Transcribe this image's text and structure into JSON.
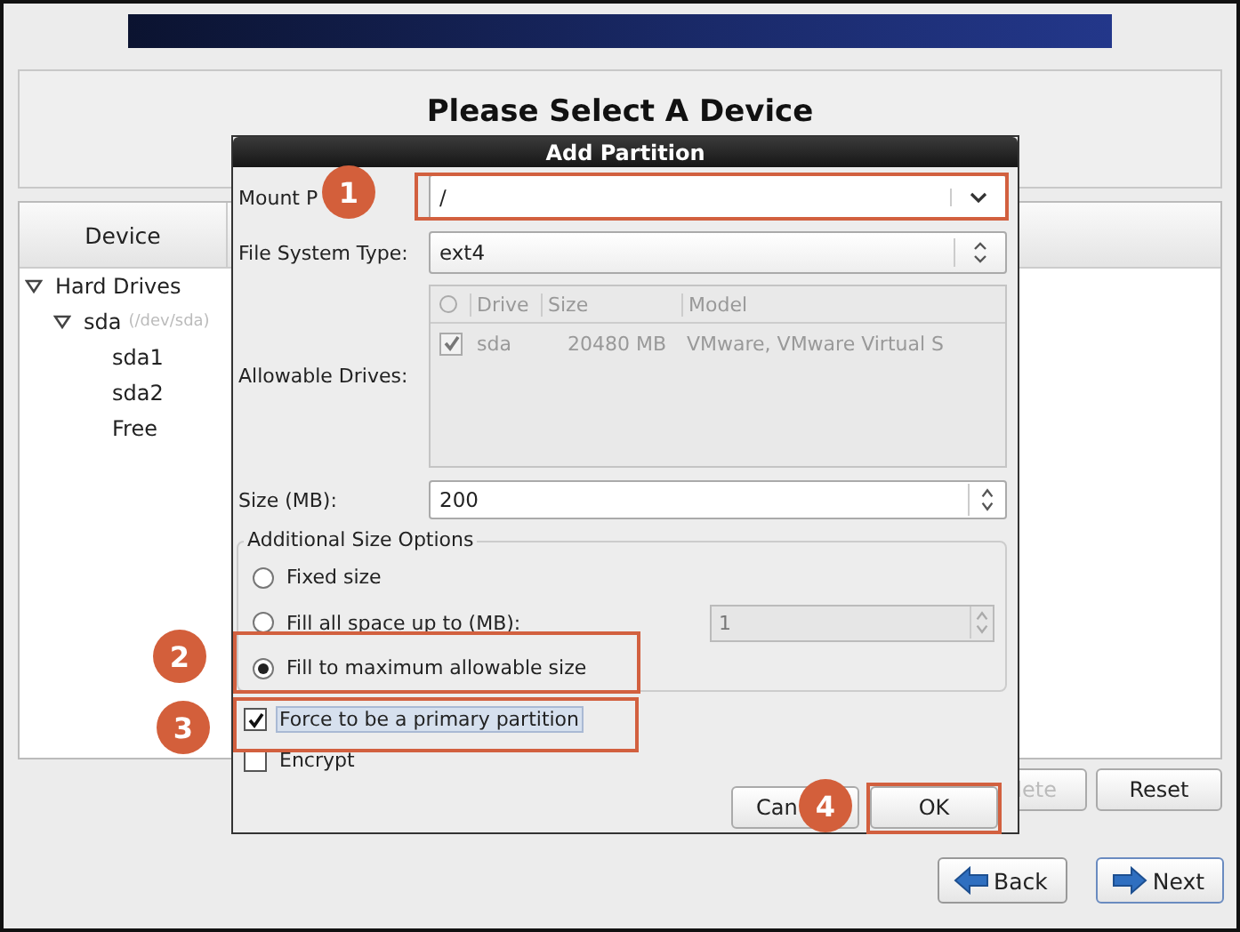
{
  "header": {
    "title": "Please Select A Device"
  },
  "device_panel": {
    "column": "Device",
    "tree": [
      {
        "label": "Hard Drives",
        "expanded": true,
        "children": [
          {
            "label": "sda",
            "detail": "(/dev/sda)",
            "expanded": true,
            "children": [
              {
                "label": "sda1"
              },
              {
                "label": "sda2"
              },
              {
                "label": "Free"
              }
            ]
          }
        ]
      }
    ]
  },
  "panel_buttons": [
    {
      "label": "lete",
      "disabled": true
    },
    {
      "label": "Reset",
      "disabled": false
    }
  ],
  "nav_buttons": [
    {
      "label": "Back",
      "kind": "back"
    },
    {
      "label": "Next",
      "kind": "next"
    }
  ],
  "dialog": {
    "title": "Add Partition",
    "mount_point": {
      "label": "Mount P",
      "value": "/"
    },
    "file_system_type": {
      "label": "File System Type:",
      "value": "ext4"
    },
    "allowable_drives": {
      "label": "Allowable Drives:",
      "disabled": true,
      "columns": [
        "Drive",
        "Size",
        "Model"
      ],
      "rows": [
        {
          "checked": true,
          "drive": "sda",
          "size": "20480 MB",
          "model": "VMware, VMware Virtual S"
        }
      ]
    },
    "size": {
      "label": "Size (MB):",
      "value": "200"
    },
    "size_options": {
      "title": "Additional Size Options",
      "options": [
        {
          "label": "Fixed size",
          "selected": false
        },
        {
          "label": "Fill all space up to (MB):",
          "selected": false,
          "value": "1",
          "disabled": true
        },
        {
          "label": "Fill to maximum allowable size",
          "selected": true
        }
      ]
    },
    "checkboxes": [
      {
        "label": "Force to be a primary partition",
        "checked": true,
        "focused": true
      },
      {
        "label": "Encrypt",
        "checked": false,
        "focused": false
      }
    ],
    "buttons": [
      "Can",
      "OK"
    ]
  },
  "annotations": [
    {
      "number": "1"
    },
    {
      "number": "2"
    },
    {
      "number": "3"
    },
    {
      "number": "4"
    }
  ]
}
